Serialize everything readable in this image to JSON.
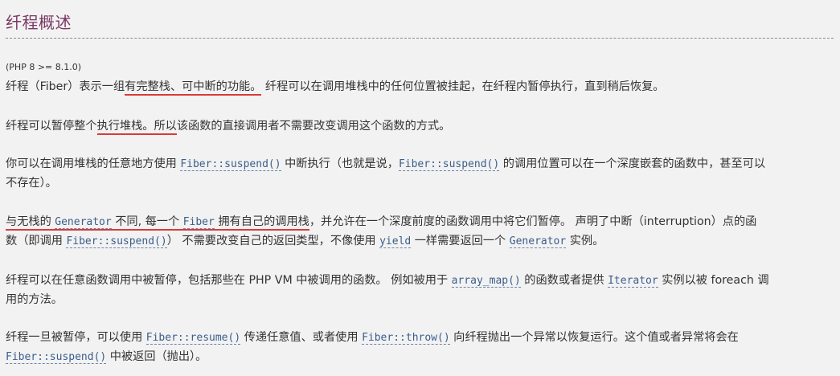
{
  "title": "纤程概述",
  "version": "(PHP 8 >= 8.1.0)",
  "colors": {
    "title": "#793862",
    "link": "#3b5e8c",
    "highlight_underline": "#d93a3a",
    "background": "#f2f2f2",
    "text": "#333333"
  },
  "p1": {
    "a": "纤程（Fiber）表示一组",
    "hl": "有完整栈、可中断的功能。",
    "b": " 纤程可以在调用堆栈中的任何位置被挂起，在纤程内暂停执行，直到稍后恢复。"
  },
  "p2": {
    "a": "纤程可以暂停整个",
    "hl1": "执行堆栈。",
    "hl2": "所以",
    "b": "该函数的直接调用者不需要改变调用这个函数的方式。"
  },
  "p3": {
    "a": "你可以在调用堆栈的任意地方使用 ",
    "link1": "Fiber::suspend()",
    "b": " 中断执行（也就是说，",
    "link2": "Fiber::suspend()",
    "c": " 的调用位置可以在一个深度嵌套的函数中，甚至可以",
    "d": "不存在）。"
  },
  "p4": {
    "hl_a": "与无栈的 ",
    "link1": "Generator",
    "hl_b": " 不同, 每一个 ",
    "link2": "Fiber",
    "hl_c": " 拥有自己的调用栈",
    "a": "，并允许在一个深度前度的函数调用中将它们暂停。 声明了中断（interruption）点的函",
    "b": "数（即调用 ",
    "link3": "Fiber::suspend()",
    "c": "） 不需要改变自己的返回类型，不像使用 ",
    "link4": "yield",
    "d": " 一样需要返回一个 ",
    "link5": "Generator",
    "e": " 实例。"
  },
  "p5": {
    "a": "纤程可以在任意函数调用中被暂停，包括那些在 PHP VM 中被调用的函数。 例如被用于 ",
    "link1": "array_map()",
    "b": " 的函数或者提供 ",
    "link2": "Iterator",
    "c": " 实例以被 foreach 调",
    "d": "用的方法。"
  },
  "p6": {
    "a": "纤程一旦被暂停，可以使用 ",
    "link1": "Fiber::resume()",
    "b": " 传递任意值、或者使用 ",
    "link2": "Fiber::throw()",
    "c": " 向纤程抛出一个异常以恢复运行。这个值或者异常将会在",
    "link3": "Fiber::suspend()",
    "d": " 中被返回（抛出）。"
  }
}
